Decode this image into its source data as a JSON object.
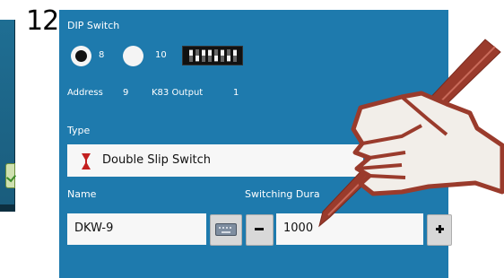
{
  "step_number": "12",
  "dip": {
    "title": "DIP Switch",
    "option_8": "8",
    "option_10": "10",
    "selected": "8",
    "switch_pattern": [
      "on",
      "off",
      "on",
      "on",
      "off",
      "on",
      "off",
      "on"
    ]
  },
  "address": {
    "address_label": "Address",
    "address_value": "9",
    "output_label": "K83 Output",
    "output_value": "1"
  },
  "type": {
    "label": "Type",
    "value": "Double Slip Switch",
    "icon": "double-slip-switch-icon"
  },
  "name": {
    "label": "Name",
    "value": "DKW-9",
    "keyboard_icon": "keyboard-icon"
  },
  "switching": {
    "label": "Switching Dura",
    "value": "1000",
    "decrement_label": "minus-icon",
    "increment_label": "plus-icon"
  },
  "colors": {
    "panel": "#1e7aad",
    "annotation": "#9a3b2c"
  }
}
